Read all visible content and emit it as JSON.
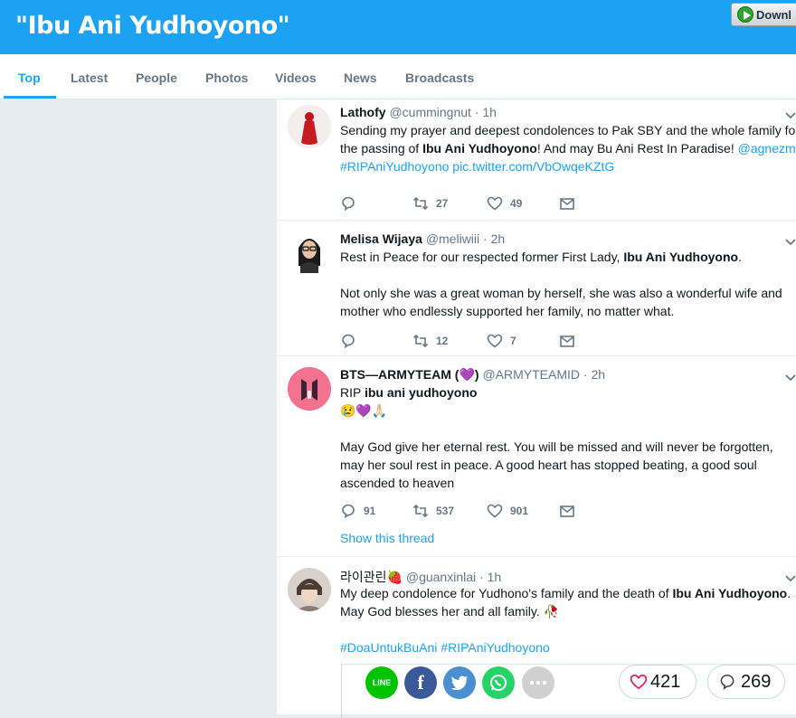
{
  "header": {
    "title": "\"Ibu Ani Yudhoyono\"",
    "download_label": "Downl"
  },
  "tabs": [
    "Top",
    "Latest",
    "People",
    "Photos",
    "Videos",
    "News",
    "Broadcasts"
  ],
  "active_tab": "Top",
  "colors": {
    "brand": "#1da1f2",
    "text": "#14171a",
    "muted": "#657786"
  },
  "tweets": [
    {
      "name": "Lathofy",
      "handle": "@cummingnut",
      "time": "· 1h",
      "lines": [
        "Sending my prayer and deepest condolences to Pak SBY and the whole family for",
        [
          "the passing of ",
          "Ibu Ani Yudhoyono",
          "! And may Bu Ani Rest In Paradise! ",
          "@agnezmo"
        ],
        [
          "#RIPAniYudhoyono pic.twitter.com/VbOwqeKZtG"
        ]
      ],
      "replies": "",
      "retweets": "27",
      "likes": "49"
    },
    {
      "name": "Melisa Wijaya",
      "handle": "@meliwiii",
      "time": "· 2h",
      "line1_pre": "Rest in Peace for our respected former First Lady, ",
      "line1_bold": "Ibu Ani Yudhoyono",
      "line1_post": ".",
      "line2": "Not only she was a great woman by herself, she was also a wonderful wife and",
      "line3": "mother who endlessly supported her family, no matter what.",
      "replies": "",
      "retweets": "12",
      "likes": "7"
    },
    {
      "name": "BTS—ARMYTEAM (",
      "name_emoji": "💜",
      "name_close": ")",
      "handle": "@ARMYTEAMID",
      "time": "· 2h",
      "line1_pre": "RIP ",
      "line1_bold": "ibu ani yudhoyono",
      "emoji_line": "😢💜🙏🏻",
      "line2": "May God give her eternal rest. You will be missed and will never be forgotten,",
      "line3": "may her soul rest in peace. A good heart has stopped beating, a good soul",
      "line4": "ascended to heaven",
      "replies": "91",
      "retweets": "537",
      "likes": "901",
      "show_thread": "Show this thread"
    },
    {
      "name": "라이관린",
      "name_emoji": "🍓",
      "handle": "@guanxinlai",
      "time": "· 1h",
      "line1_pre": "My deep condolence for Yudhono's family and the death of ",
      "line1_bold": "Ibu Ani Yudhoyono",
      "line1_post": ".",
      "line2": "May God blesses her and all family. 🥀",
      "line3": "#DoaUntukBuAni #RIPAniYudhoyono"
    }
  ],
  "share_card": {
    "like_count": "421",
    "comment_count": "269"
  }
}
